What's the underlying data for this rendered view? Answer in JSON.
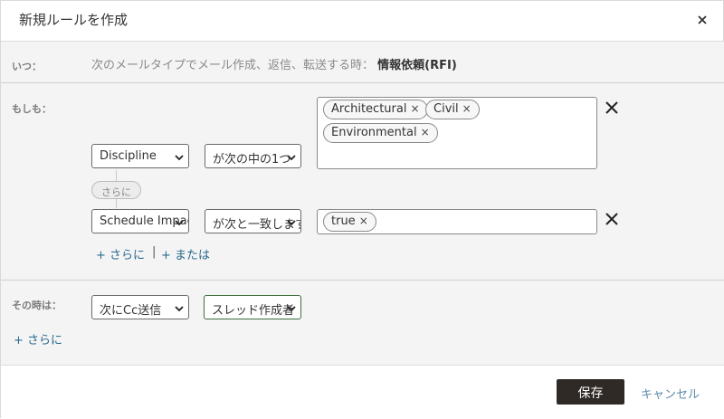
{
  "dialog": {
    "title": "新規ルールを作成"
  },
  "when": {
    "label": "いつ：",
    "text": "次のメールタイプでメール作成、返信、転送する時：",
    "value": "情報依頼(RFI)"
  },
  "if": {
    "label": "もしも：",
    "conditions": [
      {
        "field": "Discipline",
        "operator": "が次の中の1つ",
        "tags": [
          "Architectural",
          "Civil",
          "Environmental"
        ]
      },
      {
        "field": "Schedule Impact",
        "operator": "が次と一致します",
        "tags": [
          "true"
        ]
      }
    ],
    "and_chip": "さらに",
    "add_and": "+ さらに",
    "separator": "|",
    "add_or": "+ または"
  },
  "then": {
    "label": "その時は：",
    "action": "次にCc送信",
    "target": "スレッド作成者",
    "add_and": "+ さらに"
  },
  "footer": {
    "save": "保存",
    "cancel": "キャンセル"
  },
  "colors": {
    "accent_dark": "#2f2a26",
    "link": "#2b6b8f",
    "section_bg": "#f4f4f4"
  },
  "icons": {
    "close": "close-icon",
    "remove_condition": "remove-condition-icon",
    "dropdown": "chevron-down-icon",
    "tag_remove": "tag-remove-icon"
  }
}
